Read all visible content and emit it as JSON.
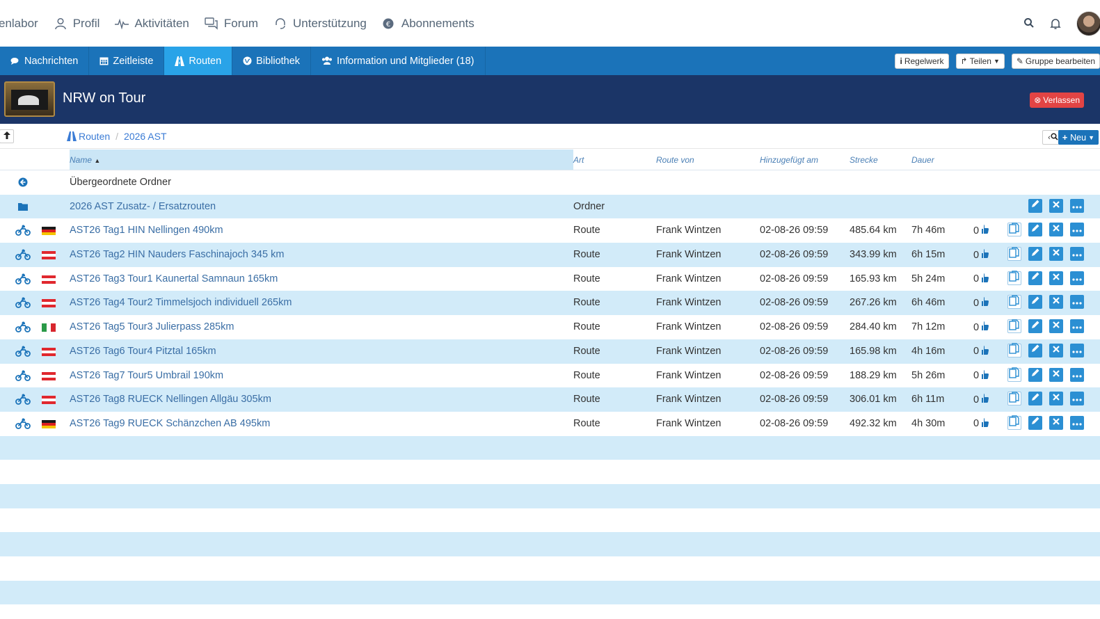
{
  "topnav": {
    "items": [
      {
        "label": "enlabor",
        "icon": "none"
      },
      {
        "label": "Profil",
        "icon": "user-icon"
      },
      {
        "label": "Aktivitäten",
        "icon": "activity-icon"
      },
      {
        "label": "Forum",
        "icon": "chat-icon"
      },
      {
        "label": "Unterstützung",
        "icon": "headset-icon"
      },
      {
        "label": "Abonnements",
        "icon": "euro-icon"
      }
    ]
  },
  "tabs": [
    {
      "label": "Nachrichten",
      "icon": "comments-icon",
      "active": false
    },
    {
      "label": "Zeitleiste",
      "icon": "calendar-icon",
      "active": false
    },
    {
      "label": "Routen",
      "icon": "road-icon",
      "active": true
    },
    {
      "label": "Bibliothek",
      "icon": "globe-icon",
      "active": false
    },
    {
      "label": "Information und Mitglieder (18)",
      "icon": "users-icon",
      "active": false
    }
  ],
  "tab_actions": {
    "rules": "Regelwerk",
    "share": "Teilen",
    "edit_group": "Gruppe bearbeiten"
  },
  "group": {
    "title": "NRW on Tour",
    "leave": "Verlassen"
  },
  "breadcrumb": {
    "root": "Routen",
    "current": "2026 AST"
  },
  "new_button": "Neu",
  "columns": {
    "name": "Name",
    "art": "Art",
    "von": "Route von",
    "date": "Hinzugefügt am",
    "dist": "Strecke",
    "dur": "Dauer"
  },
  "parent_folder": "Übergeordnete Ordner",
  "folder": {
    "name": "2026 AST Zusatz- / Ersatzrouten",
    "art": "Ordner"
  },
  "routes": [
    {
      "flag": "de",
      "name": "AST26 Tag1 HIN Nellingen 490km",
      "art": "Route",
      "von": "Frank Wintzen",
      "date": "02-08-26 09:59",
      "dist": "485.64 km",
      "dur": "7h 46m",
      "likes": "0"
    },
    {
      "flag": "at",
      "name": "AST26 Tag2 HIN Nauders Faschinajoch 345 km",
      "art": "Route",
      "von": "Frank Wintzen",
      "date": "02-08-26 09:59",
      "dist": "343.99 km",
      "dur": "6h 15m",
      "likes": "0"
    },
    {
      "flag": "at",
      "name": "AST26 Tag3 Tour1 Kaunertal Samnaun 165km",
      "art": "Route",
      "von": "Frank Wintzen",
      "date": "02-08-26 09:59",
      "dist": "165.93 km",
      "dur": "5h 24m",
      "likes": "0"
    },
    {
      "flag": "at",
      "name": "AST26 Tag4 Tour2 Timmelsjoch individuell 265km",
      "art": "Route",
      "von": "Frank Wintzen",
      "date": "02-08-26 09:59",
      "dist": "267.26 km",
      "dur": "6h 46m",
      "likes": "0"
    },
    {
      "flag": "it",
      "name": "AST26 Tag5 Tour3 Julierpass 285km",
      "art": "Route",
      "von": "Frank Wintzen",
      "date": "02-08-26 09:59",
      "dist": "284.40 km",
      "dur": "7h 12m",
      "likes": "0"
    },
    {
      "flag": "at",
      "name": "AST26 Tag6 Tour4 Pitztal 165km",
      "art": "Route",
      "von": "Frank Wintzen",
      "date": "02-08-26 09:59",
      "dist": "165.98 km",
      "dur": "4h 16m",
      "likes": "0"
    },
    {
      "flag": "at",
      "name": "AST26 Tag7 Tour5 Umbrail 190km",
      "art": "Route",
      "von": "Frank Wintzen",
      "date": "02-08-26 09:59",
      "dist": "188.29 km",
      "dur": "5h 26m",
      "likes": "0"
    },
    {
      "flag": "at",
      "name": "AST26 Tag8 RUECK Nellingen Allgäu 305km",
      "art": "Route",
      "von": "Frank Wintzen",
      "date": "02-08-26 09:59",
      "dist": "306.01 km",
      "dur": "6h 11m",
      "likes": "0"
    },
    {
      "flag": "de",
      "name": "AST26 Tag9 RUECK Schänzchen AB 495km",
      "art": "Route",
      "von": "Frank Wintzen",
      "date": "02-08-26 09:59",
      "dist": "492.32 km",
      "dur": "4h 30m",
      "likes": "0"
    }
  ],
  "colors": {
    "tabbar": "#1b73b9",
    "tab_active": "#29a3e8",
    "group_header": "#1b3567",
    "row_alt": "#d2ebf9",
    "leave": "#e24444",
    "link": "#3a6ea5"
  }
}
